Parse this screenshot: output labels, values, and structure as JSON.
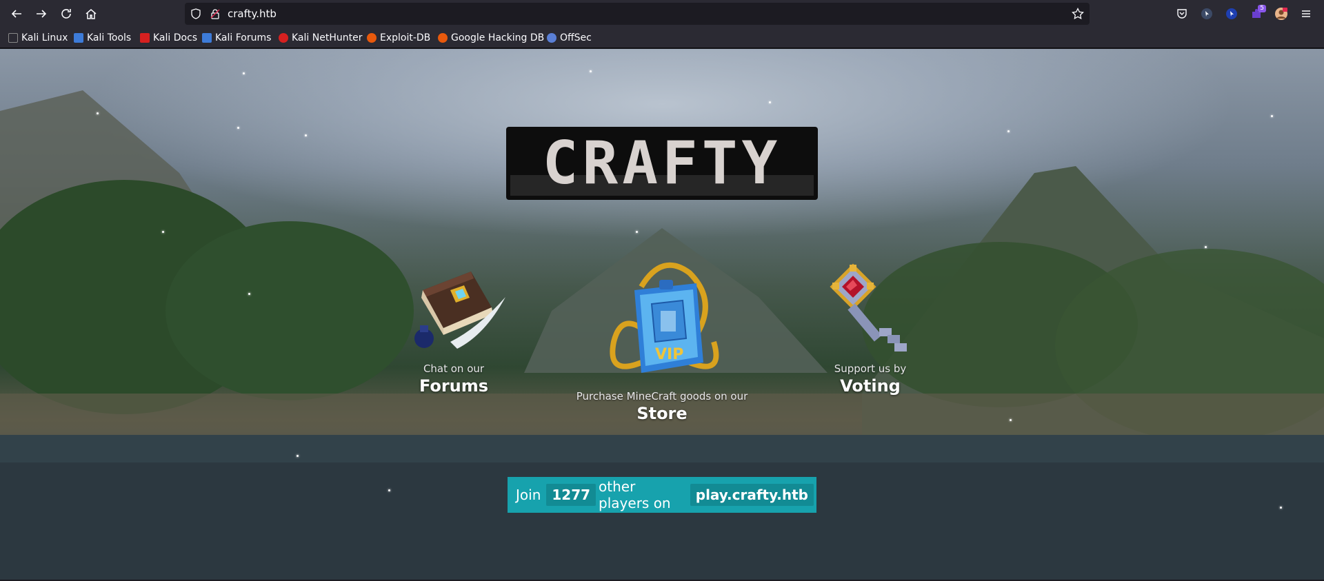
{
  "browser": {
    "url": "crafty.htb",
    "extension_badge": "5",
    "bookmarks": [
      {
        "label": "Kali Linux",
        "color": "#ffffff"
      },
      {
        "label": "Kali Tools",
        "color": "#3d7bd8"
      },
      {
        "label": "Kali Docs",
        "color": "#d62020"
      },
      {
        "label": "Kali Forums",
        "color": "#3d7bd8"
      },
      {
        "label": "Kali NetHunter",
        "color": "#d62020"
      },
      {
        "label": "Exploit-DB",
        "color": "#e8590c"
      },
      {
        "label": "Google Hacking DB",
        "color": "#e8590c"
      },
      {
        "label": "OffSec",
        "color": "#5a7fd6"
      }
    ]
  },
  "page": {
    "logo_text": "CRAFTY",
    "features": {
      "forums": {
        "sub": "Chat on our",
        "title": "Forums",
        "icon": "book-quill-icon"
      },
      "store": {
        "sub": "Purchase MineCraft goods on our",
        "title": "Store",
        "icon": "vip-pass-icon"
      },
      "voting": {
        "sub": "Support us by",
        "title": "Voting",
        "icon": "key-icon"
      }
    },
    "join": {
      "prefix": "Join",
      "count": "1277",
      "middle": "other players on",
      "server": "play.crafty.htb"
    }
  },
  "colors": {
    "accent": "#17a2ad",
    "accent_dark": "#128b94",
    "chrome": "#2b2a33"
  }
}
